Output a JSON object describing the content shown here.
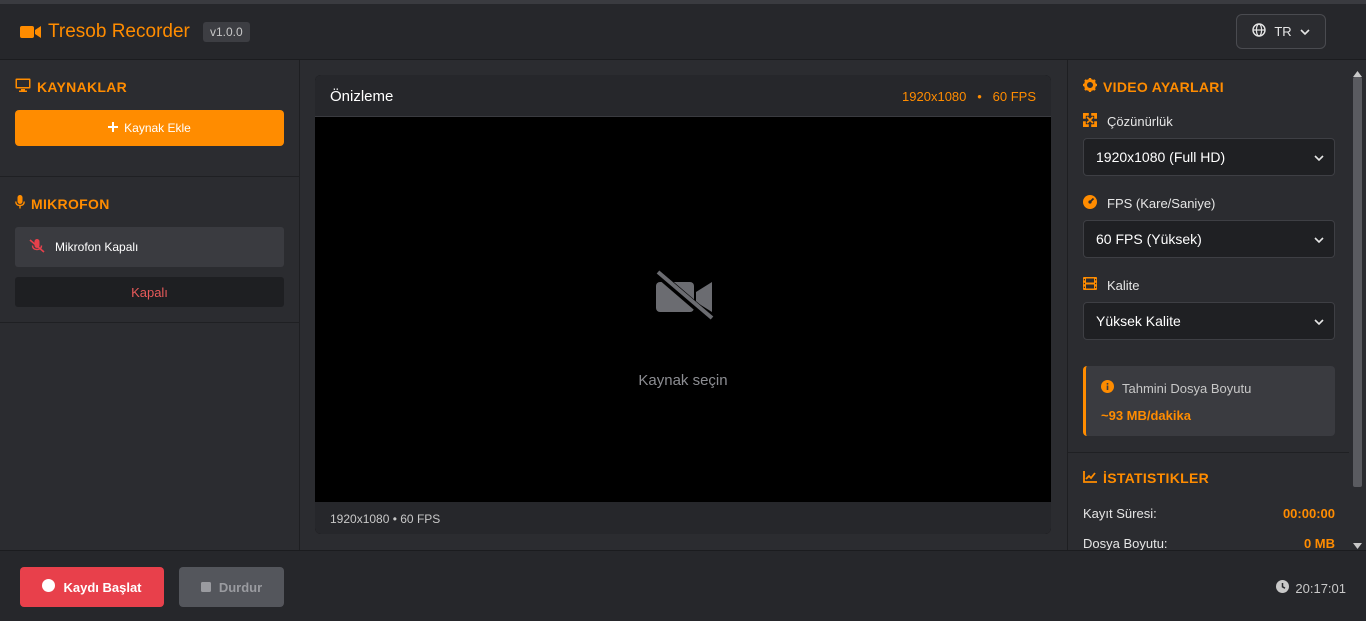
{
  "header": {
    "app_title": "Tresob Recorder",
    "version": "v1.0.0",
    "language": "TR"
  },
  "sources": {
    "title": "KAYNAKLAR",
    "add_label": "Kaynak Ekle"
  },
  "microphone": {
    "title": "MIKROFON",
    "device_label": "Mikrofon Kapalı",
    "state_label": "Kapalı"
  },
  "preview": {
    "title": "Önizleme",
    "resolution": "1920x1080",
    "separator": "•",
    "fps": "60 FPS",
    "placeholder": "Kaynak seçin",
    "footer_info": "1920x1080 • 60 FPS"
  },
  "video_settings": {
    "title": "VIDEO AYARLARI",
    "resolution_label": "Çözünürlük",
    "resolution_value": "1920x1080 (Full HD)",
    "fps_label": "FPS (Kare/Saniye)",
    "fps_value": "60 FPS (Yüksek)",
    "quality_label": "Kalite",
    "quality_value": "Yüksek Kalite",
    "estimate_title": "Tahmini Dosya Boyutu",
    "estimate_value": "~93 MB/dakika"
  },
  "statistics": {
    "title": "İSTATISTIKLER",
    "duration_label": "Kayıt Süresi:",
    "duration_value": "00:00:00",
    "size_label": "Dosya Boyutu:",
    "size_value": "0 MB"
  },
  "footer": {
    "record_label": "Kaydı Başlat",
    "stop_label": "Durdur",
    "clock": "20:17:01"
  },
  "colors": {
    "accent": "#ff8c00",
    "record": "#e8404b",
    "background": "#2b2c30"
  }
}
